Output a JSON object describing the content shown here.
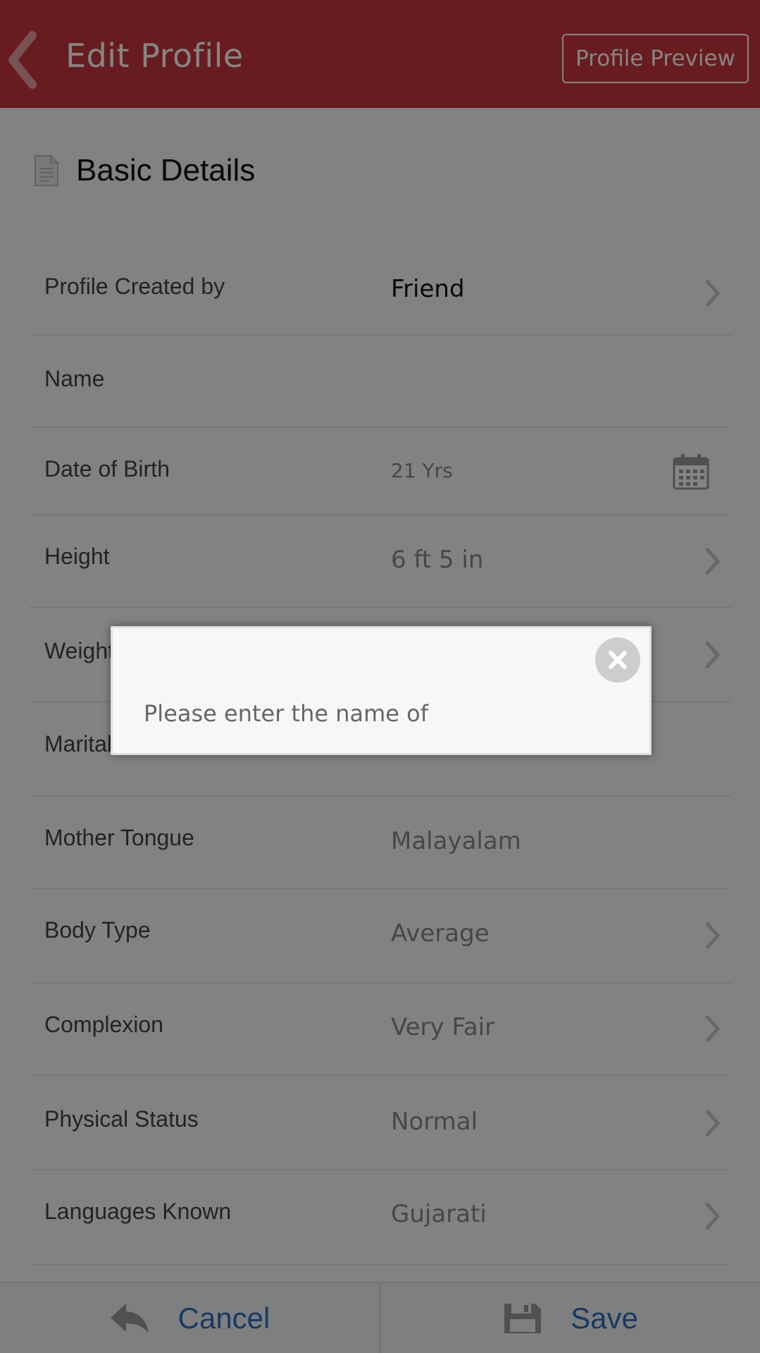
{
  "header": {
    "title": "Edit Profile",
    "preview_label": "Profile Preview",
    "back_icon": "chevron-left-icon"
  },
  "section": {
    "title": "Basic Details",
    "icon": "document-icon"
  },
  "rows": [
    {
      "label": "Profile Created by",
      "value": "Friend",
      "action": "chevron"
    },
    {
      "label": "Name",
      "value": "",
      "action": "none"
    },
    {
      "label": "Date of Birth",
      "value": "21 Yrs",
      "action": "calendar"
    },
    {
      "label": "Height",
      "value": "6 ft 5 in",
      "action": "chevron"
    },
    {
      "label": "Weight",
      "value": "",
      "action": "chevron"
    },
    {
      "label": "Marital Status",
      "value": "",
      "action": "none"
    },
    {
      "label": "Mother Tongue",
      "value": "Malayalam",
      "action": "none"
    },
    {
      "label": "Body Type",
      "value": "Average",
      "action": "chevron"
    },
    {
      "label": "Complexion",
      "value": "Very Fair",
      "action": "chevron"
    },
    {
      "label": "Physical Status",
      "value": "Normal",
      "action": "chevron"
    },
    {
      "label": "Languages Known",
      "value": "Gujarati",
      "action": "chevron"
    }
  ],
  "footer": {
    "cancel_label": "Cancel",
    "save_label": "Save"
  },
  "dialog": {
    "message": "Please enter the name of"
  },
  "colors": {
    "header_bg": "#c8373d",
    "link_blue": "#2a6fc0",
    "overlay": "rgba(0,0,0,0.48)"
  }
}
